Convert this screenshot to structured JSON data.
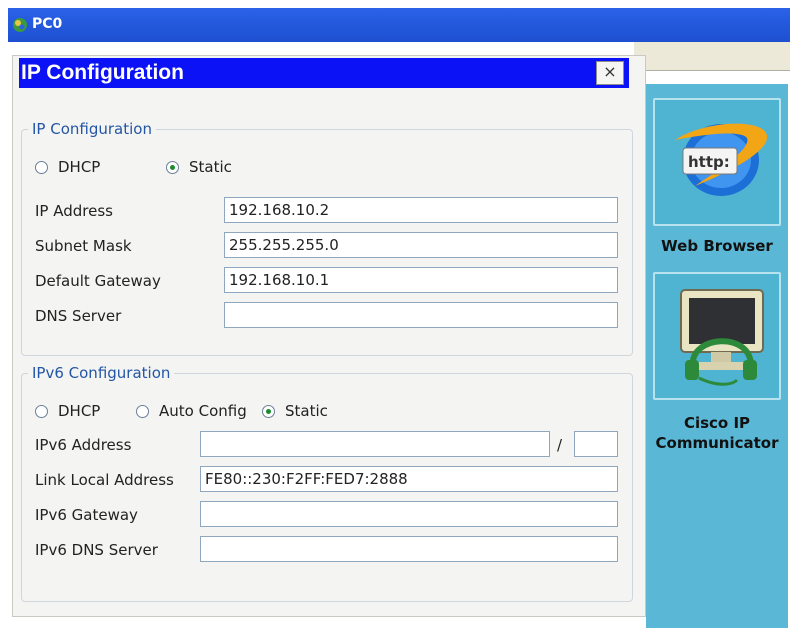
{
  "window": {
    "title": "PC0"
  },
  "dialog": {
    "title": "IP Configuration",
    "close_label": "×"
  },
  "ipv4": {
    "legend": "IP Configuration",
    "mode_dhcp": "DHCP",
    "mode_static": "Static",
    "selected_mode": "Static",
    "ip_address_label": "IP Address",
    "ip_address": "192.168.10.2",
    "subnet_mask_label": "Subnet Mask",
    "subnet_mask": "255.255.255.0",
    "gateway_label": "Default Gateway",
    "gateway": "192.168.10.1",
    "dns_label": "DNS Server",
    "dns": ""
  },
  "ipv6": {
    "legend": "IPv6 Configuration",
    "mode_dhcp": "DHCP",
    "mode_auto": "Auto Config",
    "mode_static": "Static",
    "selected_mode": "Static",
    "address_label": "IPv6 Address",
    "address": "",
    "slash": "/",
    "prefix": "",
    "link_local_label": "Link Local Address",
    "link_local": "FE80::230:F2FF:FED7:2888",
    "gateway_label": "IPv6 Gateway",
    "gateway": "",
    "dns_label": "IPv6 DNS Server",
    "dns": ""
  },
  "desktop_apps": [
    {
      "label": "Web Browser",
      "icon": "web-browser-icon",
      "icon_text": "http:"
    },
    {
      "label_line1": "Cisco IP",
      "label_line2": "Communicator",
      "icon": "ip-communicator-icon"
    }
  ],
  "colors": {
    "titlebar": "#2a62e8",
    "dialog_title": "#0b12f5",
    "app_panel": "#5ab8d6",
    "legend_text": "#2356a6"
  }
}
